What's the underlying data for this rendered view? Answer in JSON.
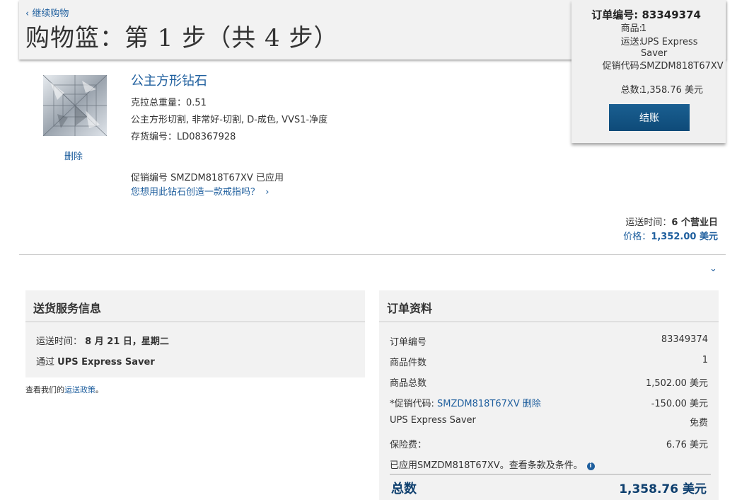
{
  "header": {
    "back_label": "继续购物",
    "title": "购物篮：第 1 步（共 4 步）"
  },
  "summary": {
    "order_label": "订单编号:",
    "order_number": "83349374",
    "items_label": "商品:",
    "items_value": "1",
    "shipping_label": "运送:",
    "shipping_value": "UPS Express Saver",
    "promo_label": "促销代码:",
    "promo_value": "SMZDM818T67XV",
    "total_label": "总数:",
    "total_value": "1,358.76 美元",
    "checkout_label": "结账"
  },
  "product": {
    "name": "公主方形钻石",
    "carat": "克拉总重量：0.51",
    "description": "公主方形切割, 非常好-切割, D-成色, VVS1-净度",
    "stock": "存货编号：LD08367928",
    "remove_label": "删除",
    "promo_applied": "促销编号 SMZDM818T67XV 已应用",
    "ring_link": "您想用此钻石创造一款戒指吗？",
    "ship_label": "运送时间：",
    "ship_value": "6 个营业日",
    "price_label": "价格：",
    "price_value": "1,352.00 美元"
  },
  "delivery": {
    "title": "送货服务信息",
    "time_label": "运送时间：",
    "time_value": "8 月 21 日，星期二",
    "via_label": "通过",
    "via_value": "UPS Express Saver",
    "policy_prefix": "查看我们的",
    "policy_link": "运送政策",
    "policy_suffix": "。"
  },
  "order_info": {
    "title": "订单资料",
    "rows": [
      {
        "label": "订单编号",
        "value": "83349374"
      },
      {
        "label": "商品件数",
        "value": "1"
      },
      {
        "label": "商品总数",
        "value": "1,502.00 美元"
      },
      {
        "label": "*促销代码:",
        "value": "-150.00 美元"
      },
      {
        "label": "UPS Express Saver",
        "value": "免费"
      },
      {
        "label": "保险费：",
        "value": "6.76 美元"
      }
    ],
    "promo_code": "SMZDM818T67XV",
    "promo_remove": "删除",
    "terms_note": "已应用SMZDM818T67XV。查看条款及条件。",
    "total_label": "总数",
    "total_value": "1,358.76 美元"
  }
}
